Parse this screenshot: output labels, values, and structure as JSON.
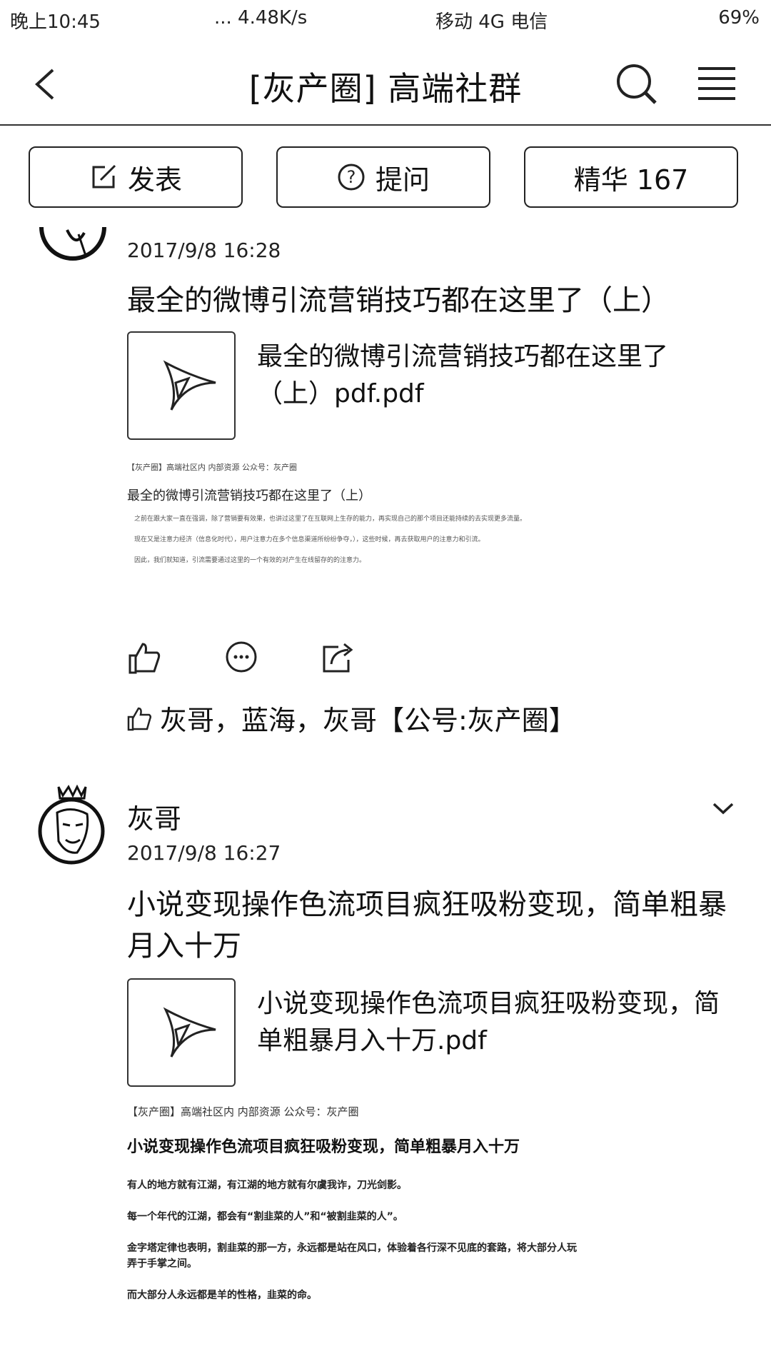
{
  "status_bar": {
    "time": "晚上10:45",
    "speed": "... 4.48K/s",
    "signal": "移动 4G  电信",
    "battery": "69%"
  },
  "header": {
    "title": "[灰产圈] 高端社群"
  },
  "actions": {
    "post_label": "发表",
    "ask_label": "提问",
    "elite_label": "精华 167"
  },
  "posts": [
    {
      "timestamp": "2017/9/8 16:28",
      "title": "最全的微博引流营销技巧都在这里了（上）",
      "attachment_name": "最全的微博引流营销技巧都在这里了（上）pdf.pdf",
      "preview": {
        "header": "【灰产圈】高端社区内 内部资源 公众号：灰产圈",
        "title": "最全的微博引流营销技巧都在这里了（上）",
        "para1": "之前在跟大家一直在强调，除了营销要有效果，也讲过这里了在互联网上生存的能力，再实现自己的那个项目还能持续的去实现更多流量。",
        "para2": "现在又是注意力经济（信息化时代），用户注意力在多个信息渠道所纷纷争夺，），这些时候，再去获取用户的注意力和引流。",
        "para3": "因此，我们就知道，引流需要通过这里的一个有效的对产生在线留存的的注意力。"
      },
      "likes": "灰哥，蓝海，灰哥【公号:灰产圈】"
    },
    {
      "author": "灰哥",
      "timestamp": "2017/9/8 16:27",
      "title": "小说变现操作色流项目疯狂吸粉变现，简单粗暴月入十万",
      "attachment_name": "小说变现操作色流项目疯狂吸粉变现，简单粗暴月入十万.pdf",
      "preview": {
        "header": "【灰产圈】高端社区内 内部资源 公众号：灰产圈",
        "title": "小说变现操作色流项目疯狂吸粉变现，简单粗暴月入十万",
        "para1": "有人的地方就有江湖，有江湖的地方就有尔虞我诈，刀光剑影。",
        "para2": "每一个年代的江湖，都会有“割韭菜的人”和“被割韭菜的人”。",
        "para3": "金字塔定律也表明，割韭菜的那一方，永远都是站在风口，体验着各行深不见底的套路，将大部分人玩弄于手掌之间。",
        "para4": "而大部分人永远都是羊的性格，韭菜的命。"
      }
    }
  ]
}
